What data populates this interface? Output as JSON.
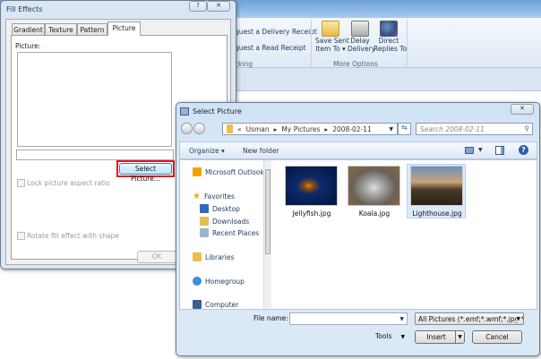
{
  "ribbon": {
    "tracking": {
      "delivery_receipt": "quest a Delivery Receipt",
      "read_receipt": "quest a Read Receipt",
      "group_label": "cking"
    },
    "more_options": {
      "save_sent_line1": "Save Sent",
      "save_sent_line2": "Item To ▾",
      "delay_line1": "Delay",
      "delay_line2": "Delivery",
      "direct_line1": "Direct",
      "direct_line2": "Replies To",
      "group_label": "More Options"
    }
  },
  "fill_effects": {
    "title": "Fill Effects",
    "help": "?",
    "close": "✕",
    "tabs": [
      "Gradient",
      "Texture",
      "Pattern",
      "Picture"
    ],
    "active_tab": "Picture",
    "picture_label": "Picture:",
    "select_picture": "Select Picture...",
    "lock_aspect": "Lock picture aspect ratio",
    "rotate_fill": "Rotate fill effect with shape",
    "ok": "OK"
  },
  "select_picture": {
    "title": "Select Picture",
    "close": "✕",
    "breadcrumb": [
      "«",
      "Usman",
      "My Pictures",
      "2008-02-11"
    ],
    "search_placeholder": "Search 2008-02-11",
    "organize": "Organize ▾",
    "new_folder": "New folder",
    "nav": [
      {
        "label": "Microsoft Outlook",
        "icon": "outlook-icon"
      },
      {
        "label": "Favorites",
        "icon": "star-icon"
      },
      {
        "label": "Desktop",
        "icon": "desktop-icon"
      },
      {
        "label": "Downloads",
        "icon": "downloads-icon"
      },
      {
        "label": "Recent Places",
        "icon": "recent-places-icon"
      },
      {
        "label": "Libraries",
        "icon": "libraries-icon"
      },
      {
        "label": "Homegroup",
        "icon": "homegroup-icon"
      },
      {
        "label": "Computer",
        "icon": "computer-icon"
      }
    ],
    "files": [
      {
        "name": "Jellyfish.jpg"
      },
      {
        "name": "Koala.jpg"
      },
      {
        "name": "Lighthouse.jpg",
        "selected": true
      }
    ],
    "file_name_label": "File name:",
    "file_name_value": "",
    "file_type": "All Pictures (*.emf;*.wmf;*.jpg;*",
    "tools": "Tools",
    "insert": "Insert",
    "cancel": "Cancel"
  },
  "colors": {
    "highlight": "#e8141b",
    "selection": "#dbeaf9"
  }
}
